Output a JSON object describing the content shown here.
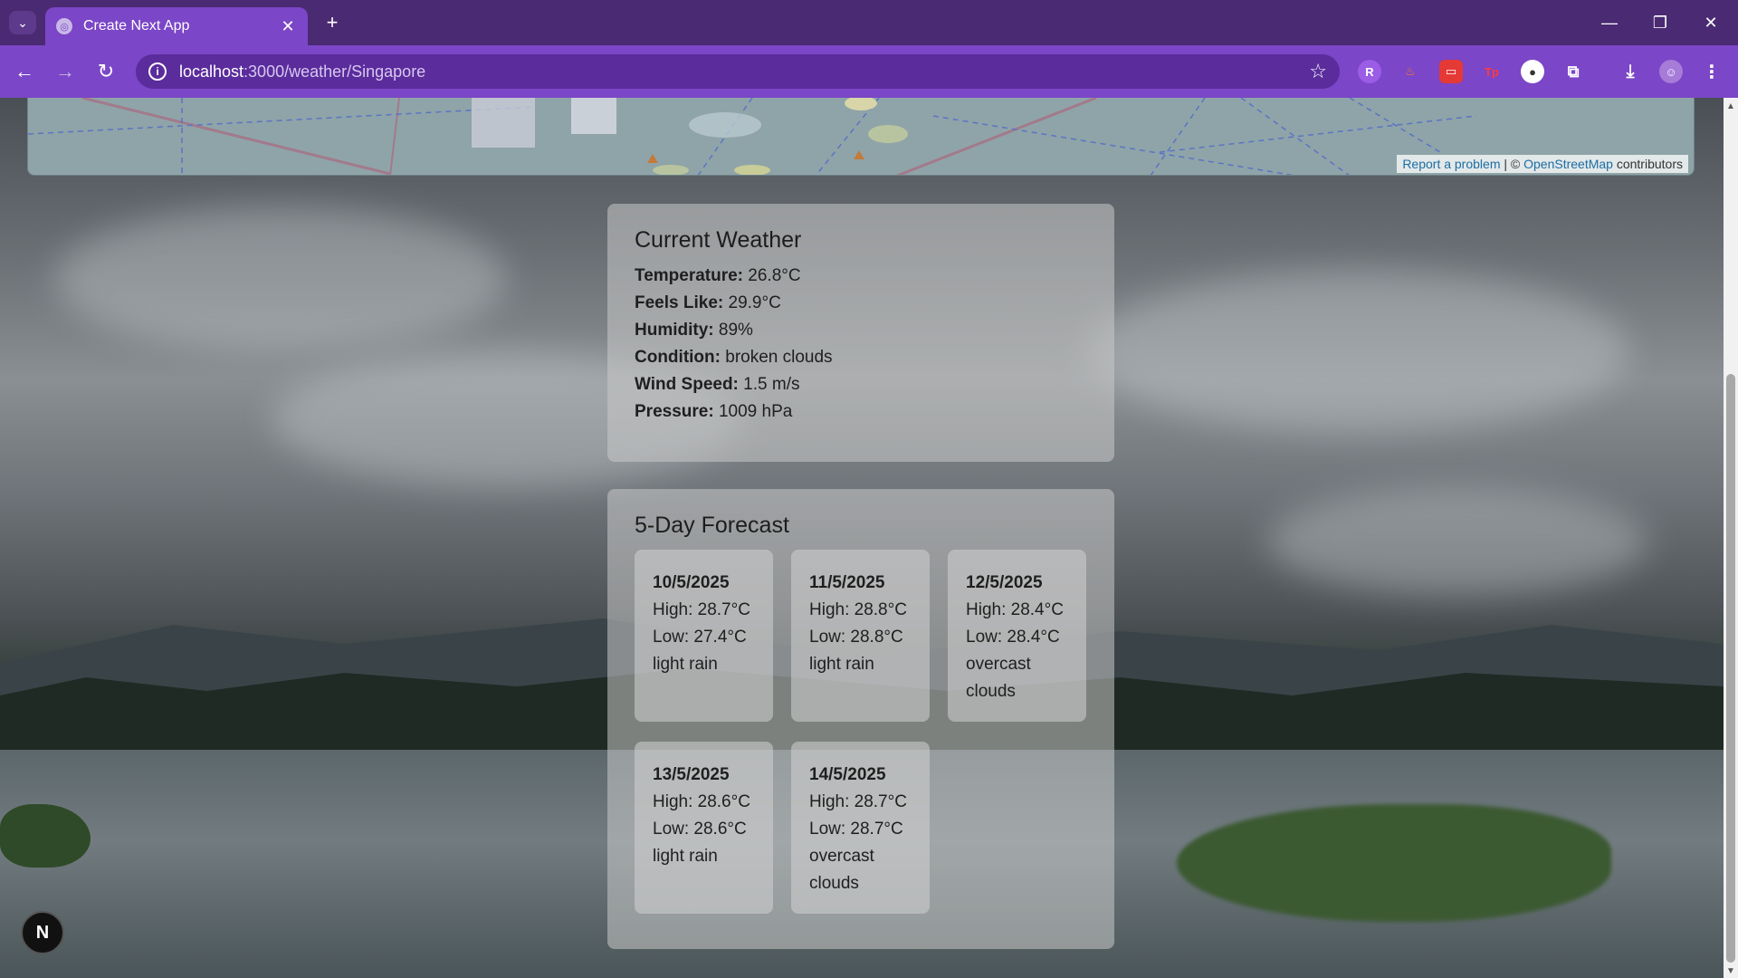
{
  "browser": {
    "tab_title": "Create Next App",
    "url_host": "localhost",
    "url_path": ":3000/weather/Singapore"
  },
  "map": {
    "attrib_report": "Report a problem",
    "attrib_sep": " | © ",
    "attrib_osm": "OpenStreetMap",
    "attrib_contrib": " contributors"
  },
  "current": {
    "title": "Current Weather",
    "rows": [
      {
        "label": "Temperature:",
        "value": "26.8°C"
      },
      {
        "label": "Feels Like:",
        "value": "29.9°C"
      },
      {
        "label": "Humidity:",
        "value": "89%"
      },
      {
        "label": "Condition:",
        "value": "broken clouds"
      },
      {
        "label": "Wind Speed:",
        "value": "1.5 m/s"
      },
      {
        "label": "Pressure:",
        "value": "1009 hPa"
      }
    ]
  },
  "forecast": {
    "title": "5-Day Forecast",
    "days": [
      {
        "date": "10/5/2025",
        "high": "High: 28.7°C",
        "low": "Low: 27.4°C",
        "desc": "light rain"
      },
      {
        "date": "11/5/2025",
        "high": "High: 28.8°C",
        "low": "Low: 28.8°C",
        "desc": "light rain"
      },
      {
        "date": "12/5/2025",
        "high": "High: 28.4°C",
        "low": "Low: 28.4°C",
        "desc": "overcast clouds"
      },
      {
        "date": "13/5/2025",
        "high": "High: 28.6°C",
        "low": "Low: 28.6°C",
        "desc": "light rain"
      },
      {
        "date": "14/5/2025",
        "high": "High: 28.7°C",
        "low": "Low: 28.7°C",
        "desc": "overcast clouds"
      }
    ]
  },
  "next_badge": "N"
}
